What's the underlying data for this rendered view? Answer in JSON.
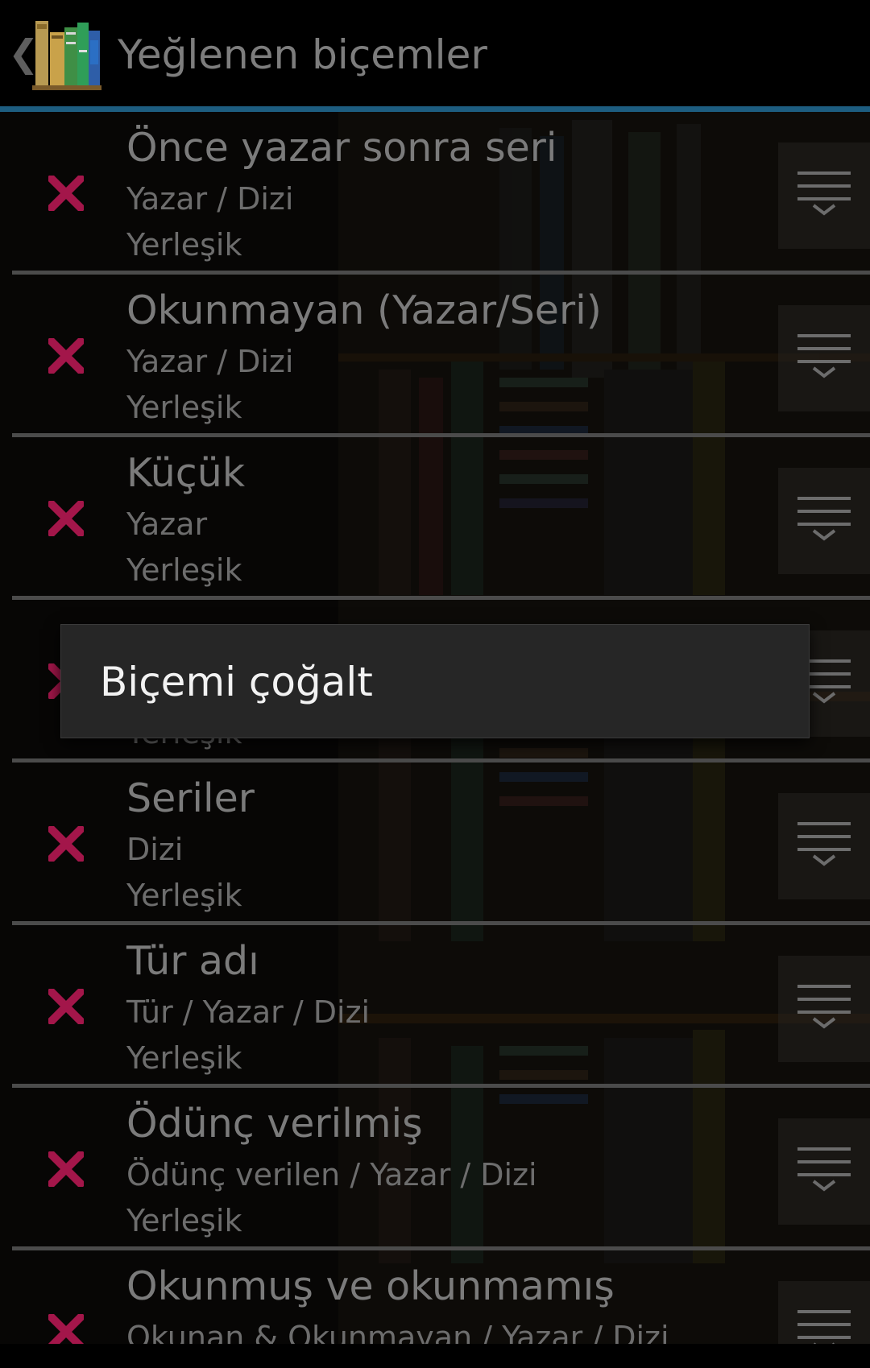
{
  "actionbar": {
    "up_icon": "chevron-left-icon",
    "app_icon": "books-icon",
    "title": "Yeğlenen biçemler",
    "divider_color": "#1d5d80"
  },
  "styles": [
    {
      "name": "Önce yazar sonra seri",
      "groups": "Yazar / Dizi",
      "kind": "Yerleşik"
    },
    {
      "name": "Okunmayan (Yazar/Seri)",
      "groups": "Yazar / Dizi",
      "kind": "Yerleşik"
    },
    {
      "name": "Küçük",
      "groups": "Yazar",
      "kind": "Yerleşik"
    },
    {
      "name": "",
      "groups": "",
      "kind": "Yerleşik"
    },
    {
      "name": "Seriler",
      "groups": "Dizi",
      "kind": "Yerleşik"
    },
    {
      "name": "Tür adı",
      "groups": "Tür / Yazar / Dizi",
      "kind": "Yerleşik"
    },
    {
      "name": "Ödünç verilmiş",
      "groups": "Ödünç verilen / Yazar / Dizi",
      "kind": "Yerleşik"
    },
    {
      "name": "Okunmuş ve okunmamış",
      "groups": "Okunan & Okunmayan / Yazar / Dizi",
      "kind": "Yerleşik"
    }
  ],
  "popup": {
    "item_label": "Biçemi çoğalt"
  },
  "colors": {
    "delete": "#a3164a",
    "popup_bg": "#262626"
  }
}
